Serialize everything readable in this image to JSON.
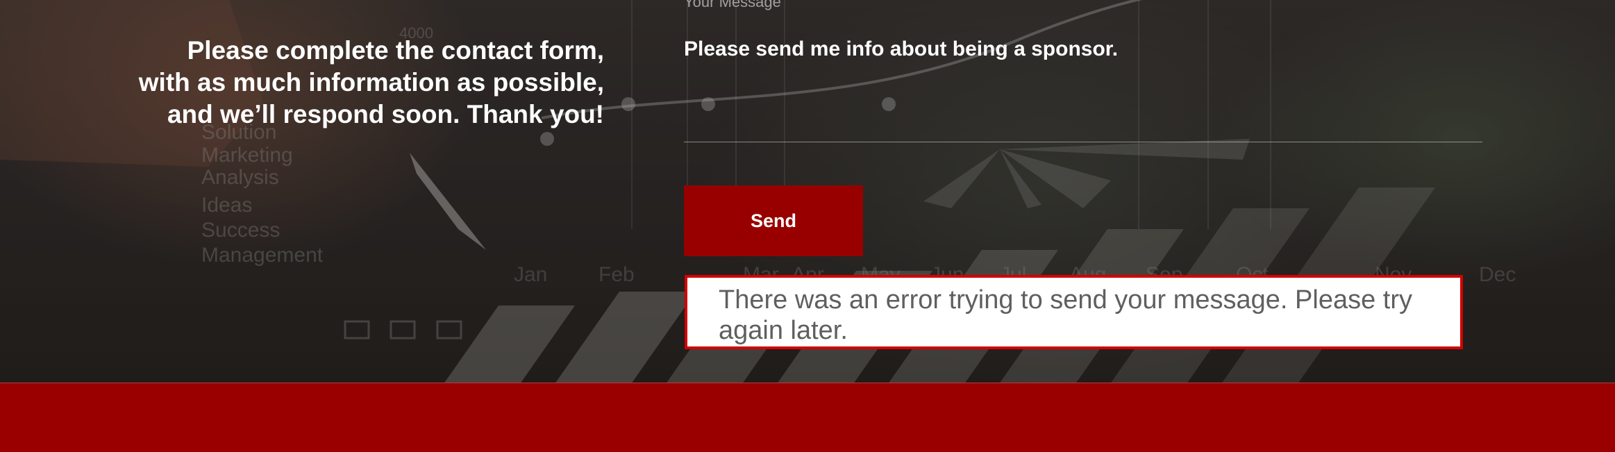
{
  "intro": {
    "lines": [
      "Please complete the contact form,",
      "with as much information as possible,",
      "and we’ll respond soon. Thank you!"
    ]
  },
  "form": {
    "message_label": "Your Message",
    "message_value": "Please send me info about being a sponsor.",
    "send_label": "Send"
  },
  "error": {
    "text": "There was an error trying to send your message. Please try again later."
  },
  "background_words": [
    "Solution",
    "Marketing",
    "Analysis",
    "Ideas",
    "Success",
    "Management"
  ],
  "background_months": [
    "Jan",
    "Feb",
    "Mar",
    "Apr",
    "May",
    "Jun",
    "Jul",
    "Aug",
    "Sep",
    "Oct",
    "Nov",
    "Dec"
  ],
  "background_number": "4000",
  "colors": {
    "brand_red": "#980000",
    "error_border": "#d30000",
    "footer_red": "#9b0000"
  }
}
